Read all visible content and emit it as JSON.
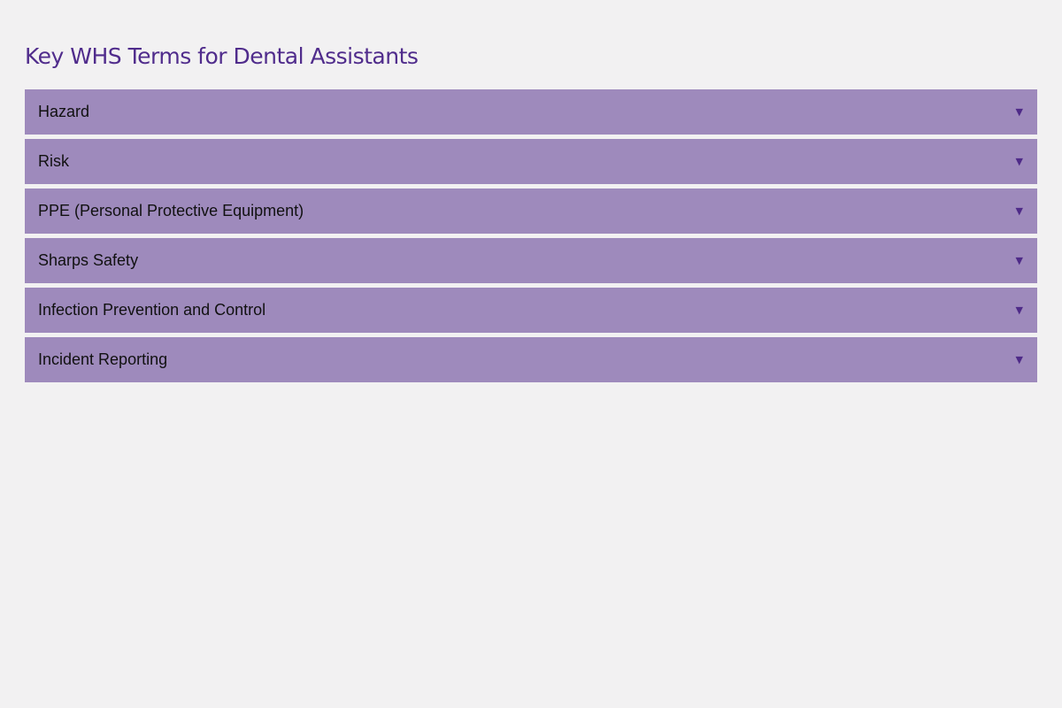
{
  "page": {
    "title": "Key WHS Terms for Dental Assistants"
  },
  "accordion": {
    "items": [
      {
        "label": "Hazard",
        "arrow": "▼",
        "icon": "chevron-down-icon"
      },
      {
        "label": "Risk",
        "arrow": "▼",
        "icon": "chevron-down-icon"
      },
      {
        "label": "PPE (Personal Protective Equipment)",
        "arrow": "▼",
        "icon": "chevron-down-icon"
      },
      {
        "label": "Sharps Safety",
        "arrow": "▼",
        "icon": "chevron-down-icon"
      },
      {
        "label": "Infection Prevention and Control",
        "arrow": "▼",
        "icon": "chevron-down-icon"
      },
      {
        "label": "Incident Reporting",
        "arrow": "▼",
        "icon": "chevron-down-icon"
      }
    ]
  },
  "colors": {
    "background": "#f2f1f2",
    "title": "#502c8c",
    "item_background": "#9e8abc",
    "arrow": "#4e2a88"
  }
}
